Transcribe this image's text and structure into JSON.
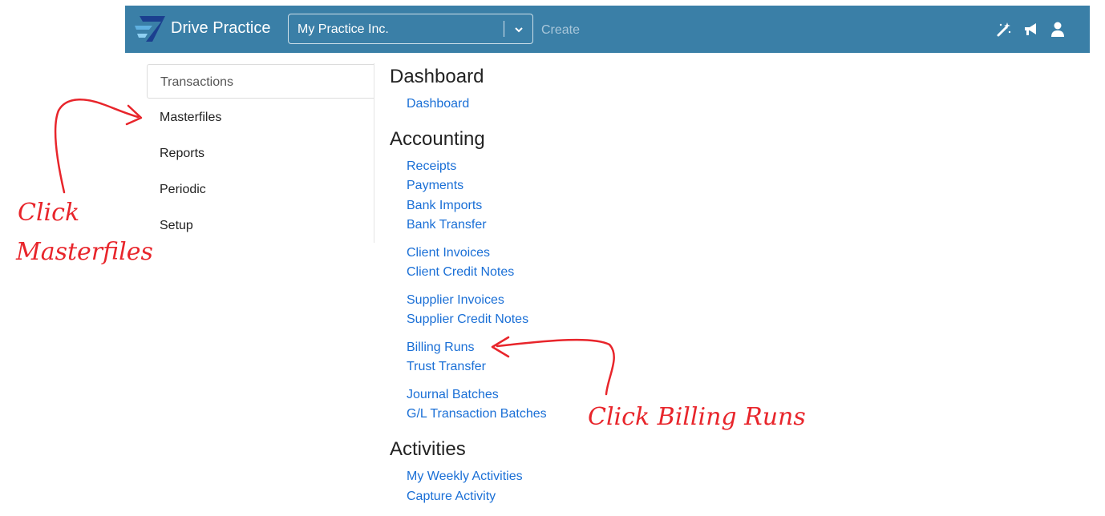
{
  "header": {
    "brand_name": "Drive Practice",
    "practice_select_value": "My Practice Inc.",
    "create_label": "Create",
    "icons": [
      "magic-wand-icon",
      "megaphone-icon",
      "user-icon"
    ]
  },
  "sidebar": {
    "items": [
      {
        "label": "Transactions",
        "active": true
      },
      {
        "label": "Masterfiles"
      },
      {
        "label": "Reports"
      },
      {
        "label": "Periodic"
      },
      {
        "label": "Setup"
      }
    ]
  },
  "sections": [
    {
      "title": "Dashboard",
      "links": [
        "Dashboard"
      ]
    },
    {
      "title": "Accounting",
      "links": [
        "Receipts",
        "Payments",
        "Bank Imports",
        "Bank Transfer",
        "Client Invoices",
        "Client Credit Notes",
        "Supplier Invoices",
        "Supplier Credit Notes",
        "Billing Runs",
        "Trust Transfer",
        "Journal Batches",
        "G/L Transaction Batches"
      ]
    },
    {
      "title": "Activities",
      "links": [
        "My Weekly Activities",
        "Capture Activity"
      ]
    }
  ],
  "annotations": {
    "masterfiles_line1": "Click",
    "masterfiles_line2": "Masterfiles",
    "billing_runs": "Click Billing Runs"
  },
  "colors": {
    "topbar": "#3a7fa7",
    "link": "#1a6fd6",
    "annotation": "#e8252b"
  }
}
